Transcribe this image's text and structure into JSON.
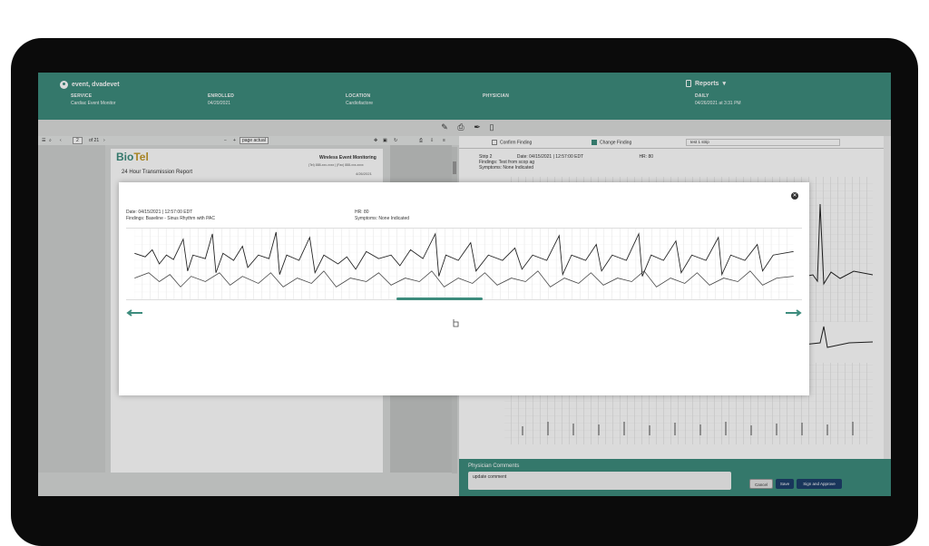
{
  "header": {
    "patient": "event, dvadevet",
    "service_label": "SERVICE",
    "service_value": "Cardiac Event Monitor",
    "enrolled_label": "ENROLLED",
    "enrolled_value": "04/20/2021",
    "location_label": "LOCATION",
    "location_value": "Cardiofactore",
    "physician_label": "PHYSICIAN",
    "reports_label": "Reports",
    "daily_label": "DAILY",
    "daily_value": "04/26/2021 at 3:31 PM"
  },
  "pdf": {
    "page_num": "2",
    "page_total": "of 21",
    "zoom": "page actual",
    "logo_a": "Bio",
    "logo_b": "Tel",
    "report_title": "24 Hour Transmission Report",
    "header_title": "Wireless Event Monitoring",
    "header_sub": "(Tel) 888-xxx-xxxx | (Fax) 888-xxx-xxxx",
    "report_date": "4/26/2021"
  },
  "finding": {
    "confirm_label": "Confirm Finding",
    "change_label": "Change Finding",
    "note_value": "test 1 strip",
    "strip_label": "Strip",
    "strip_num": "2",
    "date_line": "Date: 04/15/2021 | 12:57:00 EDT",
    "hr_line": "HR: 80",
    "findings_line": "Findings: Test from scop ag",
    "symptoms_line": "Symptoms: None Indicated"
  },
  "comments": {
    "label": "Physician Comments",
    "value": "update comment",
    "cancel": "Cancel",
    "save": "Save",
    "sign": "Sign and Approve"
  },
  "modal": {
    "date_line": "Date: 04/15/2021 | 12:57:00 EDT",
    "findings_line": "Findings: Baseline - Sinus Rhythm with PAC",
    "hr_line": "HR: 80",
    "symptoms_line": "Symptoms: None Indicated"
  },
  "colors": {
    "brand": "#3d8c7d",
    "button": "#1e3f6b"
  }
}
